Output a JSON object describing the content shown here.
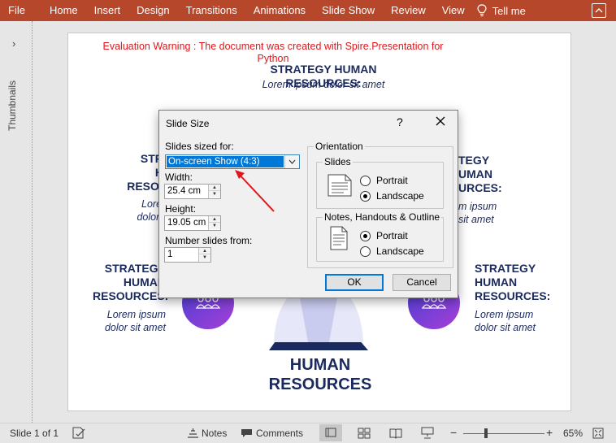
{
  "ribbon": {
    "tabs": [
      "File",
      "Home",
      "Insert",
      "Design",
      "Transitions",
      "Animations",
      "Slide Show",
      "Review",
      "View"
    ],
    "tell_me": "Tell me",
    "color": "#b7472a"
  },
  "thumbnails": {
    "label": "Thumbnails"
  },
  "slide": {
    "warning": "Evaluation Warning : The document was created with Spire.Presentation for Python",
    "top_heading": "STRATEGY HUMAN RESOURCES:",
    "top_sub": "Lorem ipsum dolor sit amet",
    "left_mid_heading_l1": "STRA",
    "left_mid_heading_l2": "H",
    "left_mid_heading_l3": "RESOU",
    "left_mid_sub_l1": "Loren",
    "left_mid_sub_l2": "dolor s",
    "right_mid_heading_l1": "TEGY",
    "right_mid_heading_l2": "UMAN",
    "right_mid_heading_l3": "URCES:",
    "right_mid_sub_l1": "m ipsum",
    "right_mid_sub_l2": "sit amet",
    "left_bot_heading_l1": "STRATEGY",
    "left_bot_heading_l2": "HUMAN",
    "left_bot_heading_l3": "RESOURCES:",
    "left_bot_sub_l1": "Lorem ipsum",
    "left_bot_sub_l2": "dolor sit amet",
    "right_bot_heading_l1": "STRATEGY",
    "right_bot_heading_l2": "HUMAN",
    "right_bot_heading_l3": "RESOURCES:",
    "right_bot_sub_l1": "Lorem ipsum",
    "right_bot_sub_l2": "dolor sit amet",
    "title_l1": "HUMAN",
    "title_l2": "RESOURCES",
    "text_color": "#1b2a5e",
    "warning_color": "#e0161a"
  },
  "dialog": {
    "title": "Slide Size",
    "help": "?",
    "sized_for_label": "Slides sized for:",
    "sized_for_value": "On-screen Show (4:3)",
    "width_label": "Width:",
    "width_value": "25.4 cm",
    "height_label": "Height:",
    "height_value": "19.05 cm",
    "number_from_label": "Number slides from:",
    "number_from_value": "1",
    "orientation_label": "Orientation",
    "slides_group": "Slides",
    "slides_portrait": "Portrait",
    "slides_landscape": "Landscape",
    "slides_selected": "Landscape",
    "notes_group": "Notes, Handouts & Outline",
    "notes_portrait": "Portrait",
    "notes_landscape": "Landscape",
    "notes_selected": "Portrait",
    "ok": "OK",
    "cancel": "Cancel"
  },
  "status": {
    "slide_of": "Slide 1 of 1",
    "notes": "Notes",
    "comments": "Comments",
    "zoom": "65%"
  }
}
